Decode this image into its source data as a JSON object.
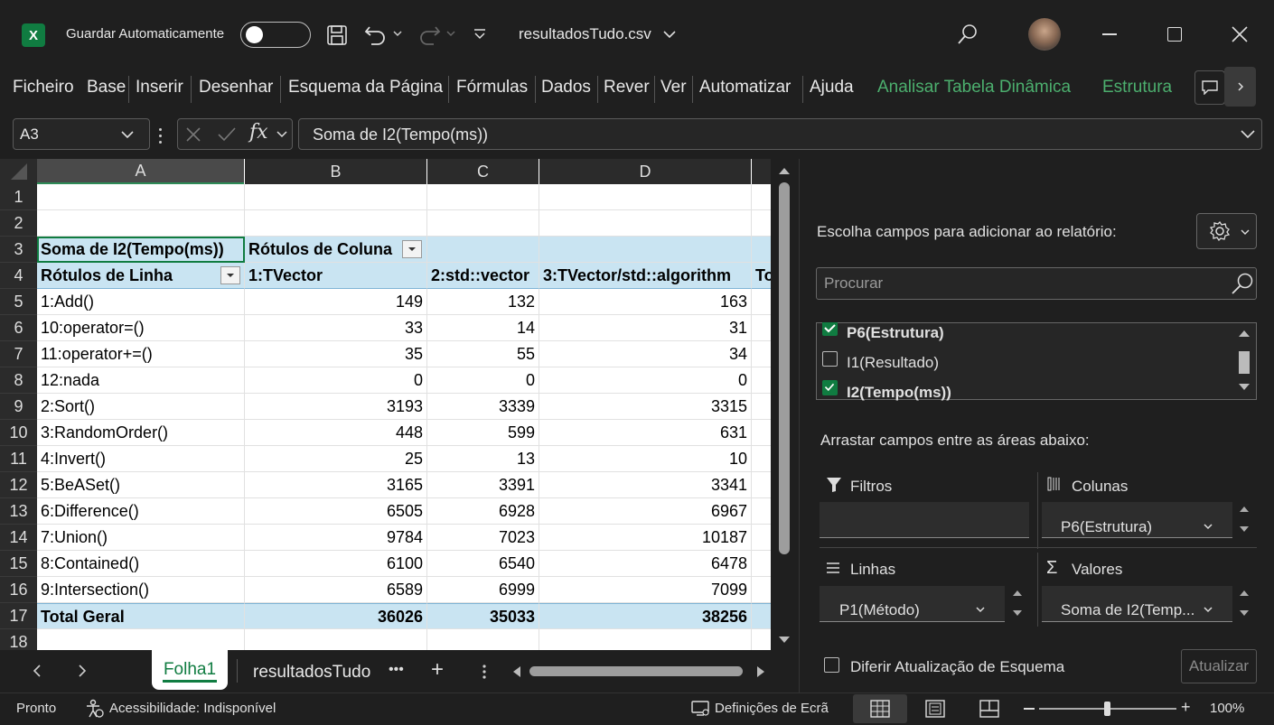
{
  "titlebar": {
    "app_logo": "X",
    "autosave_label": "Guardar Automaticamente",
    "file_name": "resultadosTudo.csv"
  },
  "ribbon": {
    "tabs": [
      "Ficheiro",
      "Base",
      "Inserir",
      "Desenhar",
      "Esquema da Página",
      "Fórmulas",
      "Dados",
      "Rever",
      "Ver",
      "Automatizar",
      "Ajuda"
    ],
    "context_tabs": [
      "Analisar Tabela Dinâmica",
      "Estrutura"
    ]
  },
  "formula_bar": {
    "name_box": "A3",
    "formula": "Soma de I2(Tempo(ms))"
  },
  "grid": {
    "columns": [
      "A",
      "B",
      "C",
      "D"
    ],
    "row_numbers": [
      "1",
      "2",
      "3",
      "4",
      "5",
      "6",
      "7",
      "8",
      "9",
      "10",
      "11",
      "12",
      "13",
      "14",
      "15",
      "16",
      "17",
      "18"
    ],
    "pivot_title": "Soma de I2(Tempo(ms))",
    "column_labels": "Rótulos de Coluna",
    "row_labels": "Rótulos de Linha",
    "col_headers": [
      "1:TVector",
      "2:std::vector",
      "3:TVector/std::algorithm",
      "To"
    ],
    "rows": [
      {
        "label": "1:Add()",
        "b": "149",
        "c": "132",
        "d": "163"
      },
      {
        "label": "10:operator=()",
        "b": "33",
        "c": "14",
        "d": "31"
      },
      {
        "label": "11:operator+=()",
        "b": "35",
        "c": "55",
        "d": "34"
      },
      {
        "label": "12:nada",
        "b": "0",
        "c": "0",
        "d": "0"
      },
      {
        "label": "2:Sort()",
        "b": "3193",
        "c": "3339",
        "d": "3315"
      },
      {
        "label": "3:RandomOrder()",
        "b": "448",
        "c": "599",
        "d": "631"
      },
      {
        "label": "4:Invert()",
        "b": "25",
        "c": "13",
        "d": "10"
      },
      {
        "label": "5:BeASet()",
        "b": "3165",
        "c": "3391",
        "d": "3341"
      },
      {
        "label": "6:Difference()",
        "b": "6505",
        "c": "6928",
        "d": "6967"
      },
      {
        "label": "7:Union()",
        "b": "9784",
        "c": "7023",
        "d": "10187"
      },
      {
        "label": "8:Contained()",
        "b": "6100",
        "c": "6540",
        "d": "6478"
      },
      {
        "label": "9:Intersection()",
        "b": "6589",
        "c": "6999",
        "d": "7099"
      }
    ],
    "total": {
      "label": "Total Geral",
      "b": "36026",
      "c": "35033",
      "d": "38256"
    }
  },
  "sheets": {
    "active": "Folha1",
    "other": "resultadosTudo",
    "more": "•••",
    "add": "+"
  },
  "status": {
    "ready": "Pronto",
    "accessibility": "Acessibilidade: Indisponível",
    "display_settings": "Definições de Ecrã",
    "zoom": "100%",
    "zoom_level": 1.0
  },
  "pivot_pane": {
    "choose_fields": "Escolha campos para adicionar ao relatório:",
    "search_placeholder": "Procurar",
    "fields": [
      {
        "name": "P6(Estrutura)",
        "checked": true
      },
      {
        "name": "I1(Resultado)",
        "checked": false
      },
      {
        "name": "I2(Tempo(ms))",
        "checked": true
      }
    ],
    "drag_label": "Arrastar campos entre as áreas abaixo:",
    "filters_label": "Filtros",
    "columns_label": "Colunas",
    "columns_value": "P6(Estrutura)",
    "rows_label": "Linhas",
    "rows_value": "P1(Método)",
    "values_label": "Valores",
    "values_value": "Soma de I2(Temp...",
    "defer_label": "Diferir Atualização de Esquema",
    "update_button": "Atualizar"
  },
  "colors": {
    "excel_green": "#107c41",
    "pivot_header": "#c9e4f2",
    "context_tab": "#4caf6e",
    "background": "#1f1f1f"
  },
  "icons": [
    "excel-logo-icon",
    "save-icon",
    "undo-icon",
    "redo-icon",
    "customize-icon",
    "search-icon",
    "avatar",
    "minimize-icon",
    "maximize-icon",
    "close-icon",
    "comments-icon",
    "ribbon-scroll-icon",
    "cancel-icon",
    "enter-icon",
    "fx-icon",
    "settings-gear-icon",
    "filter-icon",
    "columns-icon",
    "rows-icon",
    "sigma-icon",
    "accessibility-icon",
    "display-settings-icon",
    "normal-view-icon",
    "page-layout-icon",
    "page-break-icon"
  ]
}
